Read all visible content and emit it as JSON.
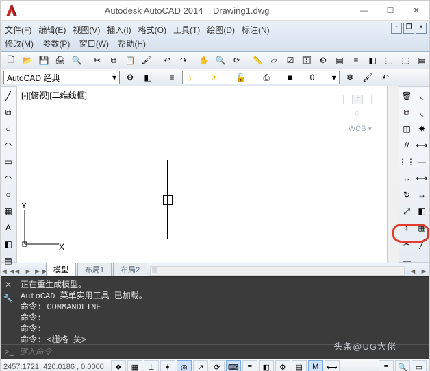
{
  "titlebar": {
    "vendor": "Autodesk AutoCAD 2014",
    "doc": "Drawing1.dwg"
  },
  "menus": {
    "row1": {
      "file": "文件(F)",
      "edit": "编辑(E)",
      "view": "视图(V)",
      "insert": "插入(I)",
      "format": "格式(O)",
      "tools": "工具(T)",
      "draw": "绘图(D)",
      "dimension": "标注(N)"
    },
    "row2": {
      "modify": "修改(M)",
      "param": "参数(P)",
      "window": "窗口(W)",
      "help": "帮助(H)"
    }
  },
  "workspace": {
    "selected": "AutoCAD 经典",
    "dropdown_glyph": "▾"
  },
  "layer": {
    "current": "0",
    "glyph_light": "☼",
    "glyph_sun": "☀",
    "glyph_lock": "🔓",
    "glyph_print": "⎙",
    "square": "■"
  },
  "viewport": {
    "label": "[-][俯视][二维线框]"
  },
  "tabs": {
    "prev": "◄◄",
    "model": "模型",
    "layout1": "布局1",
    "layout2": "布局2",
    "scroll_left": "◄",
    "scroll_right": "►"
  },
  "navcube": {
    "wcs": "WCS",
    "home": "⌂",
    "t": "上"
  },
  "cmd_lines": {
    "l1": "正在重生成模型。",
    "l2": "AutoCAD 菜单实用工具 已加载。",
    "l3": "命令: COMMANDLINE",
    "l4": "命令:",
    "l5": "命令:",
    "l6": "命令:  <栅格 关>"
  },
  "cmd_input": {
    "prompt": ">_",
    "placeholder": "键入命令"
  },
  "statusbar": {
    "coords": "2457.1721, 420.0186 , 0.0000"
  },
  "icons": {
    "new": "🗋",
    "open": "📂",
    "save": "💾",
    "plot": "🖨",
    "undo": "↶",
    "redo": "↷",
    "cut": "✂",
    "copy": "⧉",
    "paste": "📋",
    "match": "🖌",
    "line": "╱",
    "pline": "⧉",
    "circle": "○",
    "arc": "◠",
    "rect": "▭",
    "hatch": "▦",
    "text": "A",
    "dim": "⟷",
    "table": "▤",
    "pan": "✋",
    "zoom": "🔍",
    "orbit": "⟳",
    "layeriso": "❄",
    "layers": "≡",
    "block": "◧",
    "erase": "🗑",
    "grid": "▦",
    "snap": "❖",
    "ortho": "⊥",
    "polar": "✶",
    "osnap": "◎",
    "otrack": "↗",
    "dyn": "⌨",
    "lw": "≡",
    "model": "M",
    "dist": "📏",
    "area": "▱",
    "qselect": "☑",
    "dcenter": "🗄",
    "props": "⚙",
    "group": "⬚",
    "ungroup": "⬚",
    "move": "↔",
    "rotate": "↻",
    "scale": "⤢",
    "mirror": "◫",
    "offset": "//",
    "trim": "✂",
    "extend": "—",
    "fillet": "◟",
    "explode": "✸",
    "array": "⋮⋮",
    "stretch": "↕"
  },
  "watermark": "头条@UG大佬"
}
